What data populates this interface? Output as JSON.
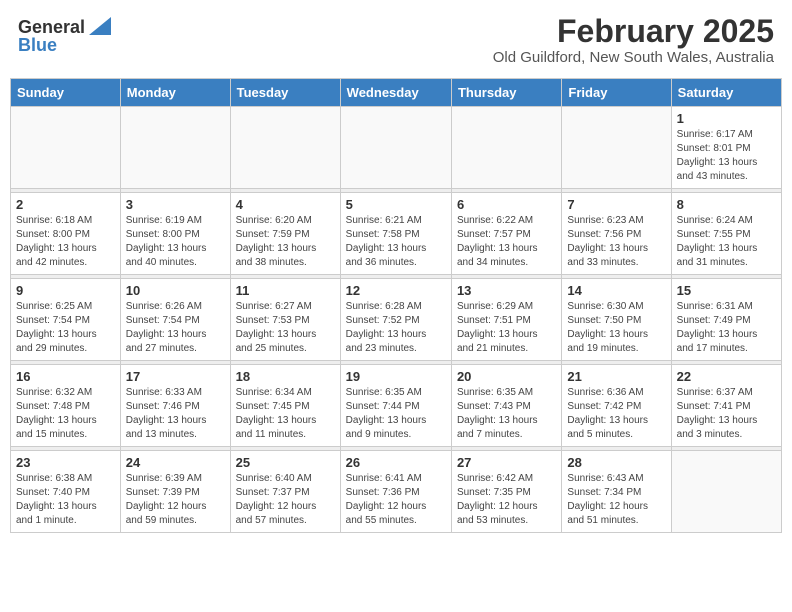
{
  "header": {
    "logo_general": "General",
    "logo_blue": "Blue",
    "month_year": "February 2025",
    "location": "Old Guildford, New South Wales, Australia"
  },
  "weekdays": [
    "Sunday",
    "Monday",
    "Tuesday",
    "Wednesday",
    "Thursday",
    "Friday",
    "Saturday"
  ],
  "weeks": [
    [
      {
        "day": "",
        "info": ""
      },
      {
        "day": "",
        "info": ""
      },
      {
        "day": "",
        "info": ""
      },
      {
        "day": "",
        "info": ""
      },
      {
        "day": "",
        "info": ""
      },
      {
        "day": "",
        "info": ""
      },
      {
        "day": "1",
        "info": "Sunrise: 6:17 AM\nSunset: 8:01 PM\nDaylight: 13 hours\nand 43 minutes."
      }
    ],
    [
      {
        "day": "2",
        "info": "Sunrise: 6:18 AM\nSunset: 8:00 PM\nDaylight: 13 hours\nand 42 minutes."
      },
      {
        "day": "3",
        "info": "Sunrise: 6:19 AM\nSunset: 8:00 PM\nDaylight: 13 hours\nand 40 minutes."
      },
      {
        "day": "4",
        "info": "Sunrise: 6:20 AM\nSunset: 7:59 PM\nDaylight: 13 hours\nand 38 minutes."
      },
      {
        "day": "5",
        "info": "Sunrise: 6:21 AM\nSunset: 7:58 PM\nDaylight: 13 hours\nand 36 minutes."
      },
      {
        "day": "6",
        "info": "Sunrise: 6:22 AM\nSunset: 7:57 PM\nDaylight: 13 hours\nand 34 minutes."
      },
      {
        "day": "7",
        "info": "Sunrise: 6:23 AM\nSunset: 7:56 PM\nDaylight: 13 hours\nand 33 minutes."
      },
      {
        "day": "8",
        "info": "Sunrise: 6:24 AM\nSunset: 7:55 PM\nDaylight: 13 hours\nand 31 minutes."
      }
    ],
    [
      {
        "day": "9",
        "info": "Sunrise: 6:25 AM\nSunset: 7:54 PM\nDaylight: 13 hours\nand 29 minutes."
      },
      {
        "day": "10",
        "info": "Sunrise: 6:26 AM\nSunset: 7:54 PM\nDaylight: 13 hours\nand 27 minutes."
      },
      {
        "day": "11",
        "info": "Sunrise: 6:27 AM\nSunset: 7:53 PM\nDaylight: 13 hours\nand 25 minutes."
      },
      {
        "day": "12",
        "info": "Sunrise: 6:28 AM\nSunset: 7:52 PM\nDaylight: 13 hours\nand 23 minutes."
      },
      {
        "day": "13",
        "info": "Sunrise: 6:29 AM\nSunset: 7:51 PM\nDaylight: 13 hours\nand 21 minutes."
      },
      {
        "day": "14",
        "info": "Sunrise: 6:30 AM\nSunset: 7:50 PM\nDaylight: 13 hours\nand 19 minutes."
      },
      {
        "day": "15",
        "info": "Sunrise: 6:31 AM\nSunset: 7:49 PM\nDaylight: 13 hours\nand 17 minutes."
      }
    ],
    [
      {
        "day": "16",
        "info": "Sunrise: 6:32 AM\nSunset: 7:48 PM\nDaylight: 13 hours\nand 15 minutes."
      },
      {
        "day": "17",
        "info": "Sunrise: 6:33 AM\nSunset: 7:46 PM\nDaylight: 13 hours\nand 13 minutes."
      },
      {
        "day": "18",
        "info": "Sunrise: 6:34 AM\nSunset: 7:45 PM\nDaylight: 13 hours\nand 11 minutes."
      },
      {
        "day": "19",
        "info": "Sunrise: 6:35 AM\nSunset: 7:44 PM\nDaylight: 13 hours\nand 9 minutes."
      },
      {
        "day": "20",
        "info": "Sunrise: 6:35 AM\nSunset: 7:43 PM\nDaylight: 13 hours\nand 7 minutes."
      },
      {
        "day": "21",
        "info": "Sunrise: 6:36 AM\nSunset: 7:42 PM\nDaylight: 13 hours\nand 5 minutes."
      },
      {
        "day": "22",
        "info": "Sunrise: 6:37 AM\nSunset: 7:41 PM\nDaylight: 13 hours\nand 3 minutes."
      }
    ],
    [
      {
        "day": "23",
        "info": "Sunrise: 6:38 AM\nSunset: 7:40 PM\nDaylight: 13 hours\nand 1 minute."
      },
      {
        "day": "24",
        "info": "Sunrise: 6:39 AM\nSunset: 7:39 PM\nDaylight: 12 hours\nand 59 minutes."
      },
      {
        "day": "25",
        "info": "Sunrise: 6:40 AM\nSunset: 7:37 PM\nDaylight: 12 hours\nand 57 minutes."
      },
      {
        "day": "26",
        "info": "Sunrise: 6:41 AM\nSunset: 7:36 PM\nDaylight: 12 hours\nand 55 minutes."
      },
      {
        "day": "27",
        "info": "Sunrise: 6:42 AM\nSunset: 7:35 PM\nDaylight: 12 hours\nand 53 minutes."
      },
      {
        "day": "28",
        "info": "Sunrise: 6:43 AM\nSunset: 7:34 PM\nDaylight: 12 hours\nand 51 minutes."
      },
      {
        "day": "",
        "info": ""
      }
    ]
  ]
}
